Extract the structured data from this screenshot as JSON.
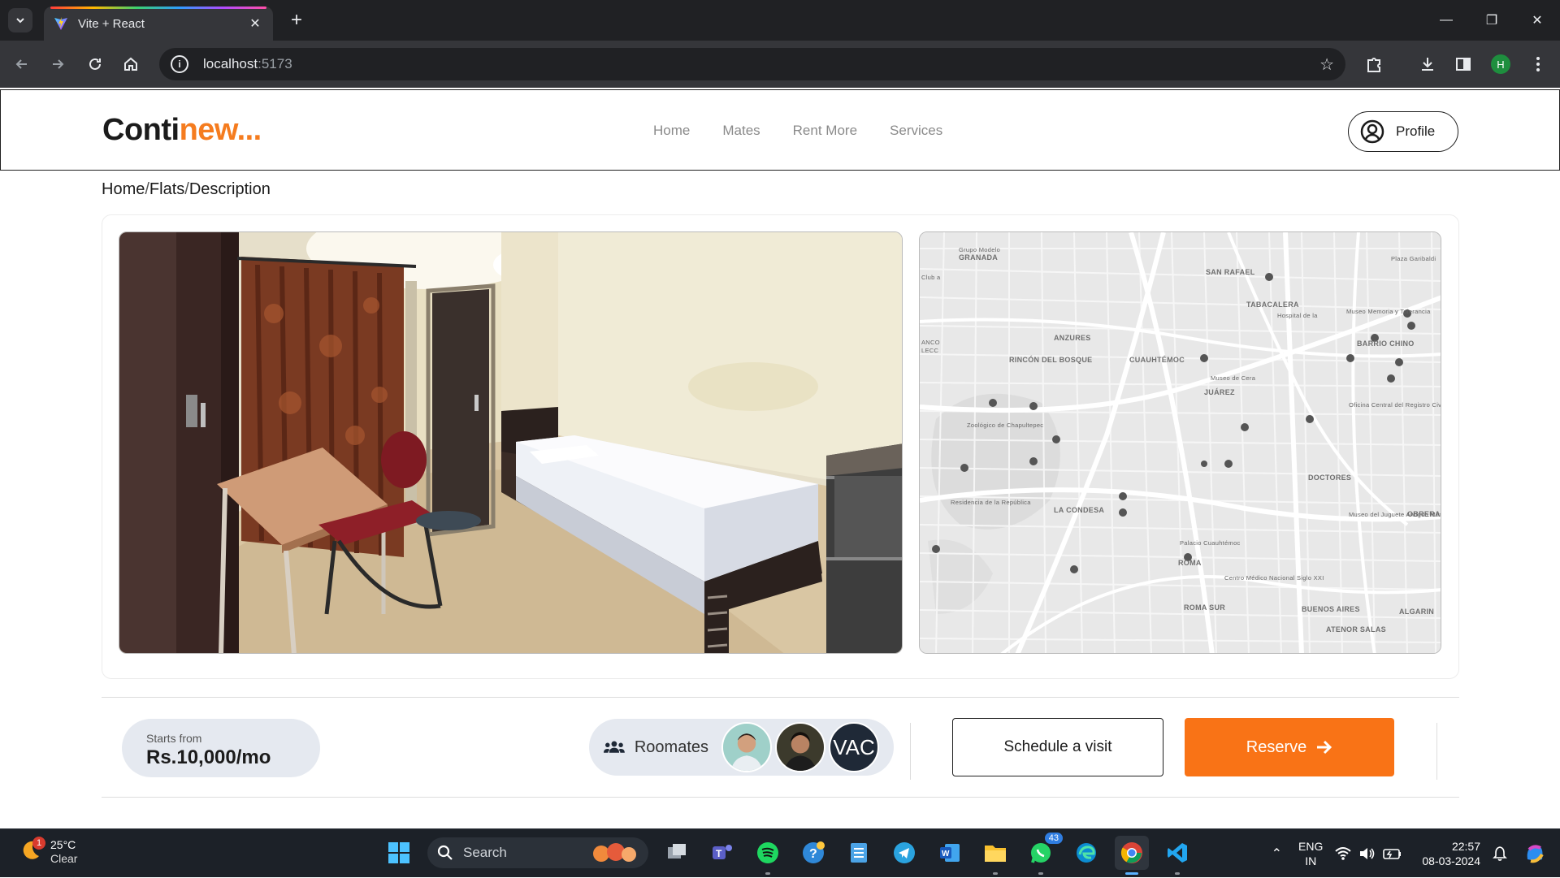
{
  "browser": {
    "tab_title": "Vite + React",
    "url_host": "localhost",
    "url_port": ":5173",
    "profile_initial": "H"
  },
  "site": {
    "logo_main": "Conti",
    "logo_accent": "new...",
    "nav": [
      "Home",
      "Mates",
      "Rent More",
      "Services"
    ],
    "profile_label": "Profile",
    "accent_color": "#f97316"
  },
  "breadcrumb": [
    "Home",
    "Flats",
    "Description"
  ],
  "map": {
    "labels": [
      "Grupo Modelo",
      "GRANADA",
      "SAN RAFAEL",
      "TABACALERA",
      "ANZURES",
      "CUAUHTÉMOC",
      "RINCÓN DEL BOSQUE",
      "BARRIO CHINO",
      "JUÁREZ",
      "DOCTORES",
      "LA CONDESA",
      "ROMA",
      "OBRERA",
      "ROMA SUR",
      "BUENOS AIRES",
      "ALGARIN",
      "ATENOR SALAS",
      "Club a",
      "ANCO",
      "LECC",
      "Zoológico de Chapultepec",
      "Residencia de la República",
      "Museo de Cera",
      "Hospital de la",
      "Museo Memoria y Tolerancia",
      "Oficina Central del Registro Civil",
      "Palacio Cuauhtémoc",
      "Centro Médico Nacional Siglo XXI",
      "Museo del Juguete Antiguo México",
      "Plaza Garibaldi"
    ]
  },
  "listing": {
    "price_label": "Starts from",
    "price_value": "Rs.10,000/mo",
    "roommates_label": "Roomates",
    "roommate_initials": "VAC",
    "schedule_label": "Schedule a visit",
    "reserve_label": "Reserve"
  },
  "taskbar": {
    "weather_temp": "25°C",
    "weather_cond": "Clear",
    "weather_badge": "1",
    "search_placeholder": "Search",
    "whatsapp_badge": "43",
    "lang_top": "ENG",
    "lang_bottom": "IN",
    "time": "22:57",
    "date": "08-03-2024"
  }
}
